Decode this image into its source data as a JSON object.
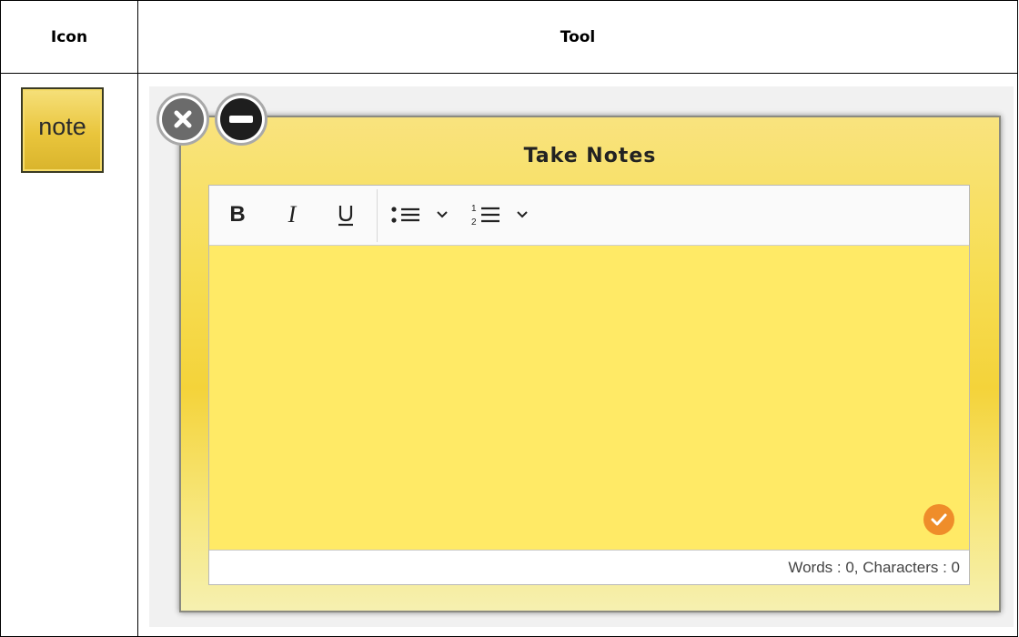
{
  "table": {
    "header_icon": "Icon",
    "header_tool": "Tool"
  },
  "icon_cell": {
    "label": "note",
    "color": "#e9c53c"
  },
  "note_window": {
    "title": "Take Notes",
    "close_icon": "close-icon",
    "minimize_icon": "minimize-icon",
    "background_color": "#f7de55",
    "editor_area_color": "#ffea66",
    "toolbar": {
      "bold_label": "B",
      "italic_label": "I",
      "underline_label": "U",
      "bullet_list_icon": "bullet-list-icon",
      "numbered_list_icon": "numbered-list-icon",
      "dropdown_icon": "chevron-down-icon"
    },
    "submit_icon": "checkmark-icon",
    "submit_color": "#ef8d2a",
    "status": "Words : 0, Characters : 0"
  }
}
